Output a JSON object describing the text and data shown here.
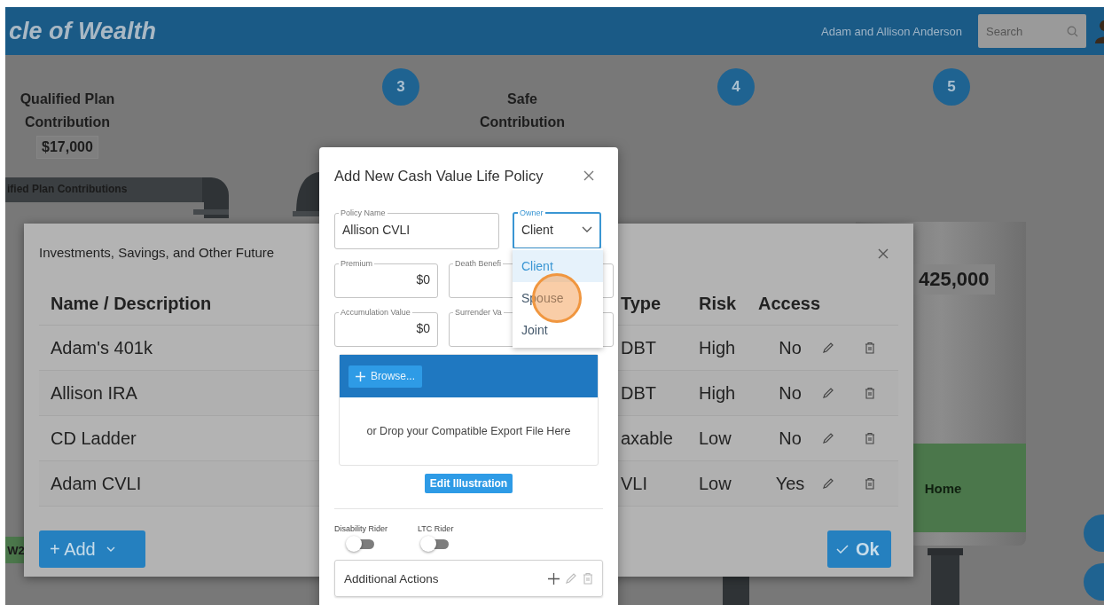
{
  "header": {
    "title": "cle of Wealth",
    "user": "Adam and Allison Anderson",
    "search": {
      "placeholder": "Search"
    }
  },
  "canvas": {
    "steps": [
      {
        "label": "3"
      },
      {
        "label": "4"
      },
      {
        "label": "5"
      }
    ],
    "qualified": {
      "title": "Qualified Plan Contribution",
      "amount": "$17,000"
    },
    "safe": {
      "title": "Safe Contribution"
    },
    "pipe_label": "ified Plan Contributions",
    "tag": "W2",
    "balance": "425,000",
    "bucket": "Home"
  },
  "investments": {
    "title": "Investments, Savings, and Other Future",
    "columns": [
      "Name / Description",
      "Type",
      "Risk",
      "Access"
    ],
    "rows": [
      {
        "name": "Adam's 401k",
        "type": "DBT",
        "risk": "High",
        "access": "No"
      },
      {
        "name": "Allison IRA",
        "type": "DBT",
        "risk": "High",
        "access": "No"
      },
      {
        "name": "CD Ladder",
        "type": "axable",
        "risk": "Low",
        "access": "No"
      },
      {
        "name": "Adam CVLI",
        "type": "VLI",
        "risk": "Low",
        "access": "Yes"
      }
    ],
    "add_button": "+ Add",
    "ok_button": "Ok"
  },
  "policy_dialog": {
    "title": "Add New Cash Value Life Policy",
    "field_rows": [
      {
        "fields": [
          {
            "kind": "text",
            "label": "Policy Name",
            "value": "Allison CVLI",
            "focused": false
          },
          {
            "kind": "select",
            "label": "Owner",
            "value": "Client",
            "focused": true
          }
        ]
      },
      {
        "fields": [
          {
            "kind": "money",
            "label": "Premium",
            "value": "$0",
            "focused": false
          },
          {
            "kind": "money",
            "label": "Death Benefi",
            "focused": false
          }
        ]
      },
      {
        "fields": [
          {
            "kind": "money",
            "label": "Accumulation Value",
            "value": "$0",
            "focused": false
          },
          {
            "kind": "money",
            "label": "Surrender Va",
            "focused": false
          }
        ]
      }
    ],
    "owner_options": [
      {
        "label": "Client",
        "selected": true
      },
      {
        "label": "Spouse",
        "selected": false
      },
      {
        "label": "Joint",
        "selected": false
      }
    ],
    "browse_button": "Browse...",
    "drop_text": "or Drop your Compatible Export File Here",
    "edit_button": "Edit Illustration",
    "toggles": [
      {
        "label": "Disability Rider",
        "on": false
      },
      {
        "label": "LTC Rider",
        "on": false
      }
    ],
    "actions_label": "Additional Actions"
  }
}
